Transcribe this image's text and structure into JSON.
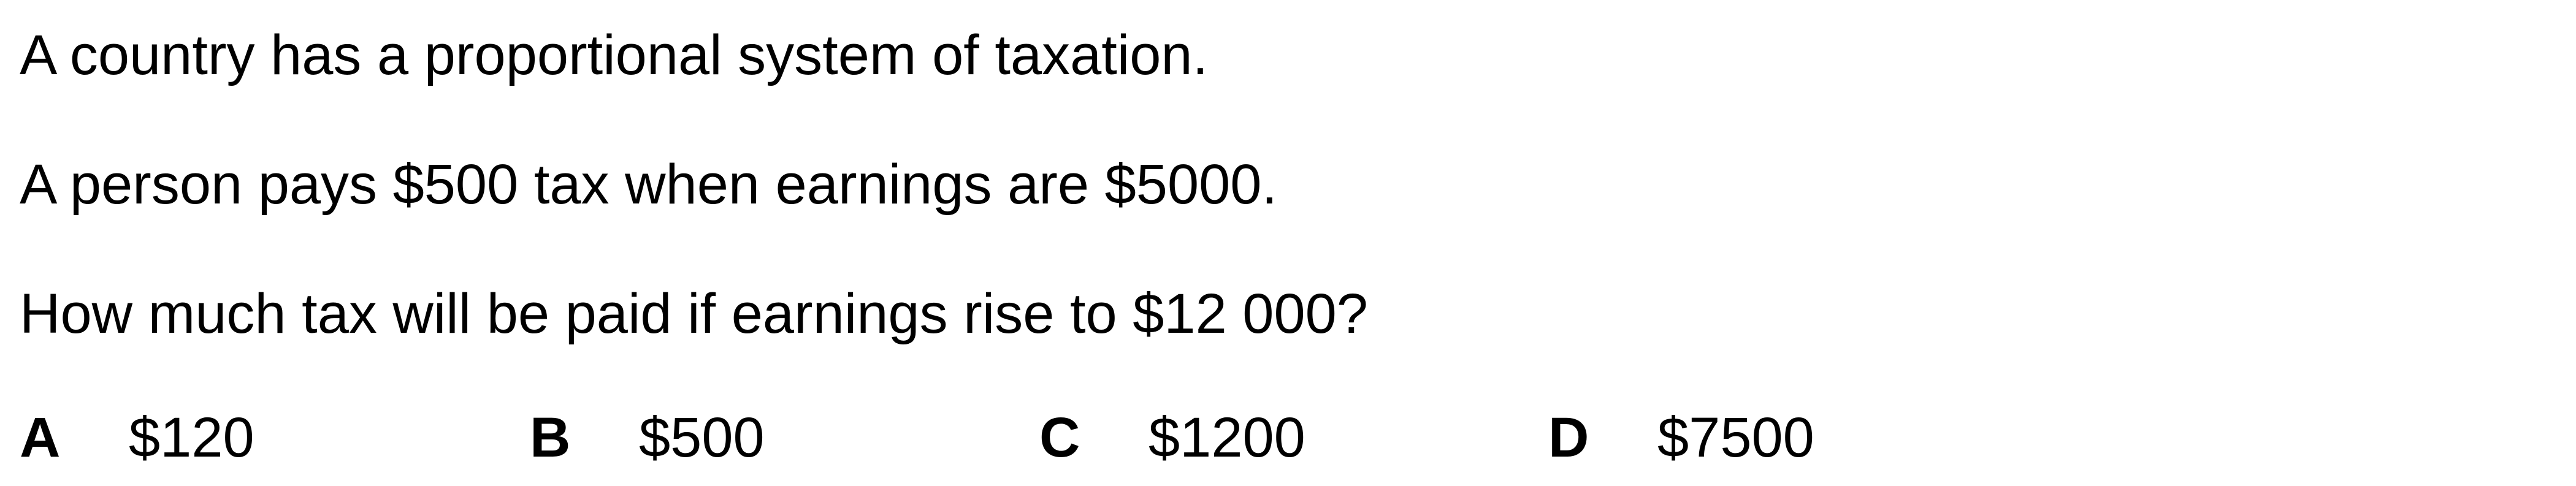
{
  "question": {
    "lines": [
      "A country has a proportional system of taxation.",
      "A person pays $500 tax when earnings are $5000.",
      "How much tax will be paid if earnings rise to $12 000?"
    ]
  },
  "options": [
    {
      "letter": "A",
      "value": "$120"
    },
    {
      "letter": "B",
      "value": "$500"
    },
    {
      "letter": "C",
      "value": "$1200"
    },
    {
      "letter": "D",
      "value": "$7500"
    }
  ]
}
